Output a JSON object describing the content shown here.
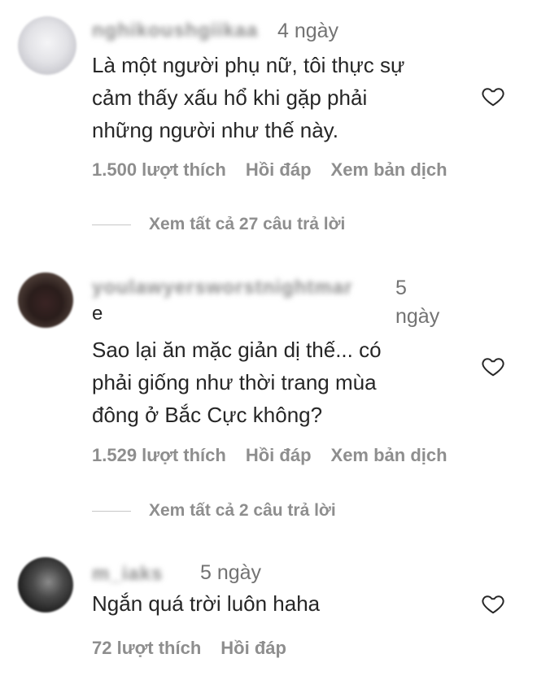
{
  "comments": [
    {
      "username": "nghikoushgiikaa",
      "time": "4 ngày",
      "text": "Là một người phụ nữ, tôi thực sự\ncảm thấy xấu hổ khi gặp phải\nnhững người như thế này.",
      "likes": "1.500 lượt thích",
      "reply": "Hồi đáp",
      "translate": "Xem bản dịch",
      "view_replies": "Xem tất cả 27 câu trả lời"
    },
    {
      "username": "youlawyersworstnightmar",
      "username_tail": "e",
      "time_line1": "5",
      "time_line2": "ngày",
      "text": "Sao lại ăn mặc giản dị thế... có\nphải giống như thời trang mùa\nđông ở Bắc Cực không?",
      "likes": "1.529 lượt thích",
      "reply": "Hồi đáp",
      "translate": "Xem bản dịch",
      "view_replies": "Xem tất cả 2 câu trả lời"
    },
    {
      "username": "m_iaks",
      "time": "5 ngày",
      "text": "Ngắn quá trời luôn haha",
      "likes": "72 lượt thích",
      "reply": "Hồi đáp"
    }
  ],
  "icons": {
    "like": "heart-outline-icon"
  }
}
